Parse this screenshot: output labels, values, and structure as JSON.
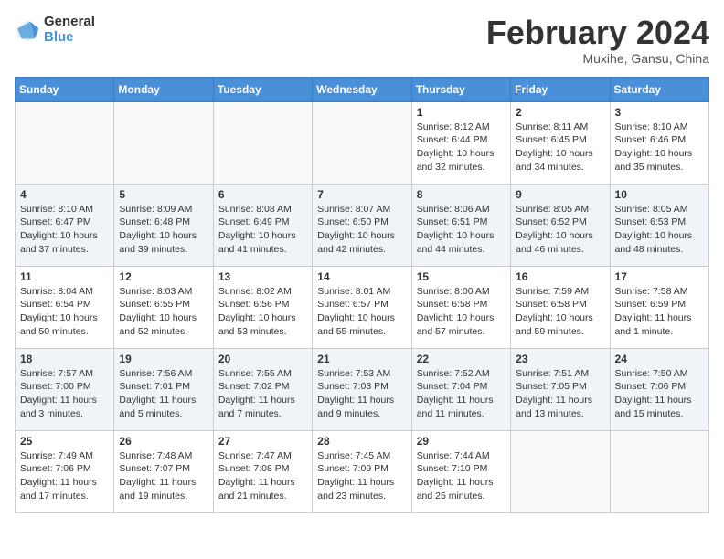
{
  "header": {
    "logo_general": "General",
    "logo_blue": "Blue",
    "month_title": "February 2024",
    "location": "Muxihe, Gansu, China"
  },
  "weekdays": [
    "Sunday",
    "Monday",
    "Tuesday",
    "Wednesday",
    "Thursday",
    "Friday",
    "Saturday"
  ],
  "weeks": [
    [
      {
        "day": "",
        "info": ""
      },
      {
        "day": "",
        "info": ""
      },
      {
        "day": "",
        "info": ""
      },
      {
        "day": "",
        "info": ""
      },
      {
        "day": "1",
        "info": "Sunrise: 8:12 AM\nSunset: 6:44 PM\nDaylight: 10 hours\nand 32 minutes."
      },
      {
        "day": "2",
        "info": "Sunrise: 8:11 AM\nSunset: 6:45 PM\nDaylight: 10 hours\nand 34 minutes."
      },
      {
        "day": "3",
        "info": "Sunrise: 8:10 AM\nSunset: 6:46 PM\nDaylight: 10 hours\nand 35 minutes."
      }
    ],
    [
      {
        "day": "4",
        "info": "Sunrise: 8:10 AM\nSunset: 6:47 PM\nDaylight: 10 hours\nand 37 minutes."
      },
      {
        "day": "5",
        "info": "Sunrise: 8:09 AM\nSunset: 6:48 PM\nDaylight: 10 hours\nand 39 minutes."
      },
      {
        "day": "6",
        "info": "Sunrise: 8:08 AM\nSunset: 6:49 PM\nDaylight: 10 hours\nand 41 minutes."
      },
      {
        "day": "7",
        "info": "Sunrise: 8:07 AM\nSunset: 6:50 PM\nDaylight: 10 hours\nand 42 minutes."
      },
      {
        "day": "8",
        "info": "Sunrise: 8:06 AM\nSunset: 6:51 PM\nDaylight: 10 hours\nand 44 minutes."
      },
      {
        "day": "9",
        "info": "Sunrise: 8:05 AM\nSunset: 6:52 PM\nDaylight: 10 hours\nand 46 minutes."
      },
      {
        "day": "10",
        "info": "Sunrise: 8:05 AM\nSunset: 6:53 PM\nDaylight: 10 hours\nand 48 minutes."
      }
    ],
    [
      {
        "day": "11",
        "info": "Sunrise: 8:04 AM\nSunset: 6:54 PM\nDaylight: 10 hours\nand 50 minutes."
      },
      {
        "day": "12",
        "info": "Sunrise: 8:03 AM\nSunset: 6:55 PM\nDaylight: 10 hours\nand 52 minutes."
      },
      {
        "day": "13",
        "info": "Sunrise: 8:02 AM\nSunset: 6:56 PM\nDaylight: 10 hours\nand 53 minutes."
      },
      {
        "day": "14",
        "info": "Sunrise: 8:01 AM\nSunset: 6:57 PM\nDaylight: 10 hours\nand 55 minutes."
      },
      {
        "day": "15",
        "info": "Sunrise: 8:00 AM\nSunset: 6:58 PM\nDaylight: 10 hours\nand 57 minutes."
      },
      {
        "day": "16",
        "info": "Sunrise: 7:59 AM\nSunset: 6:58 PM\nDaylight: 10 hours\nand 59 minutes."
      },
      {
        "day": "17",
        "info": "Sunrise: 7:58 AM\nSunset: 6:59 PM\nDaylight: 11 hours\nand 1 minute."
      }
    ],
    [
      {
        "day": "18",
        "info": "Sunrise: 7:57 AM\nSunset: 7:00 PM\nDaylight: 11 hours\nand 3 minutes."
      },
      {
        "day": "19",
        "info": "Sunrise: 7:56 AM\nSunset: 7:01 PM\nDaylight: 11 hours\nand 5 minutes."
      },
      {
        "day": "20",
        "info": "Sunrise: 7:55 AM\nSunset: 7:02 PM\nDaylight: 11 hours\nand 7 minutes."
      },
      {
        "day": "21",
        "info": "Sunrise: 7:53 AM\nSunset: 7:03 PM\nDaylight: 11 hours\nand 9 minutes."
      },
      {
        "day": "22",
        "info": "Sunrise: 7:52 AM\nSunset: 7:04 PM\nDaylight: 11 hours\nand 11 minutes."
      },
      {
        "day": "23",
        "info": "Sunrise: 7:51 AM\nSunset: 7:05 PM\nDaylight: 11 hours\nand 13 minutes."
      },
      {
        "day": "24",
        "info": "Sunrise: 7:50 AM\nSunset: 7:06 PM\nDaylight: 11 hours\nand 15 minutes."
      }
    ],
    [
      {
        "day": "25",
        "info": "Sunrise: 7:49 AM\nSunset: 7:06 PM\nDaylight: 11 hours\nand 17 minutes."
      },
      {
        "day": "26",
        "info": "Sunrise: 7:48 AM\nSunset: 7:07 PM\nDaylight: 11 hours\nand 19 minutes."
      },
      {
        "day": "27",
        "info": "Sunrise: 7:47 AM\nSunset: 7:08 PM\nDaylight: 11 hours\nand 21 minutes."
      },
      {
        "day": "28",
        "info": "Sunrise: 7:45 AM\nSunset: 7:09 PM\nDaylight: 11 hours\nand 23 minutes."
      },
      {
        "day": "29",
        "info": "Sunrise: 7:44 AM\nSunset: 7:10 PM\nDaylight: 11 hours\nand 25 minutes."
      },
      {
        "day": "",
        "info": ""
      },
      {
        "day": "",
        "info": ""
      }
    ]
  ]
}
